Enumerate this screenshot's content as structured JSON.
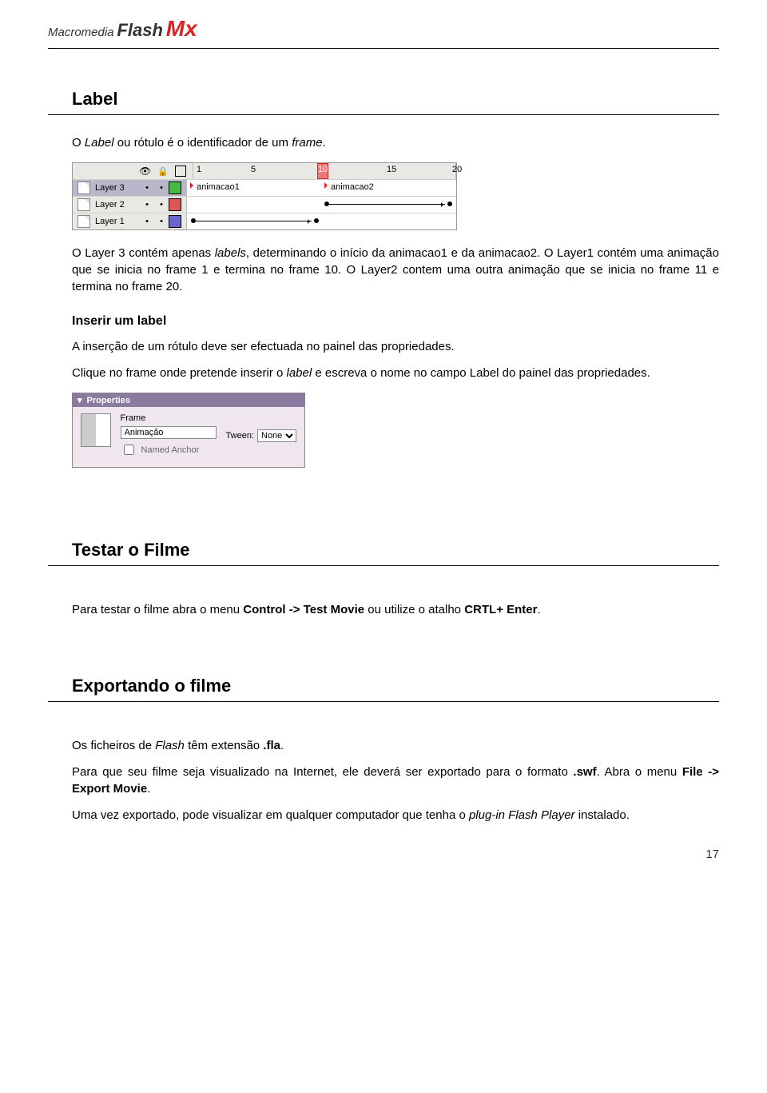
{
  "header": {
    "brand1": "Macromedia",
    "brand2": "Flash",
    "brand3": "Mx"
  },
  "s1": {
    "title": "Label",
    "p_pre": "O ",
    "p_i1": "Label",
    "p_mid1": " ou rótulo é o identificador de um ",
    "p_i2": "frame",
    "p_end1": "."
  },
  "s1cap": {
    "line1": "O Layer 3 contém apenas ",
    "line1_i": "labels",
    "line1_rest": ", determinando o início da animacao1 e da animacao2. O Layer1 contém uma animação que se inicia no frame 1 e termina no frame 10. O Layer2 contem uma outra animação que se inicia no frame 11 e termina no frame 20."
  },
  "s1sub": {
    "title": "Inserir um label",
    "p1": "A inserção de um rótulo deve ser efectuada no painel das propriedades.",
    "p2a": "Clique no frame onde pretende inserir o ",
    "p2i": "label",
    "p2b": " e escreva o nome no campo Label do painel das propriedades."
  },
  "s2": {
    "title": "Testar o Filme",
    "p_pre": "Para testar o filme abra o menu ",
    "b1": "Control -> Test Movie",
    "mid": " ou utilize o atalho ",
    "b2": "CRTL+ Enter",
    "end": "."
  },
  "s3": {
    "title": "Exportando o filme",
    "p1a": "Os ficheiros de ",
    "p1i": "Flash",
    "p1b": " têm extensão ",
    "p1bold": ".fla",
    "p1end": ".",
    "p2a": "Para que seu filme seja visualizado na Internet, ele deverá ser exportado para o formato ",
    "p2bold1": ".swf",
    "p2mid": ". Abra o menu ",
    "p2bold2": "File -> Export Movie",
    "p2end": ".",
    "p3a": "Uma vez exportado,  pode visualizar em qualquer computador que tenha o ",
    "p3i": "plug-in Flash Player",
    "p3b": " instalado."
  },
  "timeline": {
    "ruler": {
      "t1": "1",
      "t5": "5",
      "t10": "10",
      "t15": "15",
      "t20": "20"
    },
    "layers": [
      {
        "name": "Layer 3"
      },
      {
        "name": "Layer 2"
      },
      {
        "name": "Layer 1"
      }
    ],
    "label1": "animacao1",
    "label2": "animacao2"
  },
  "props": {
    "title": "Properties",
    "framelabel": "Frame",
    "value": "Animação",
    "checkbox": "Named Anchor",
    "tweenlabel": "Tween:",
    "tweenvalue": "None"
  },
  "pagenum": "17"
}
